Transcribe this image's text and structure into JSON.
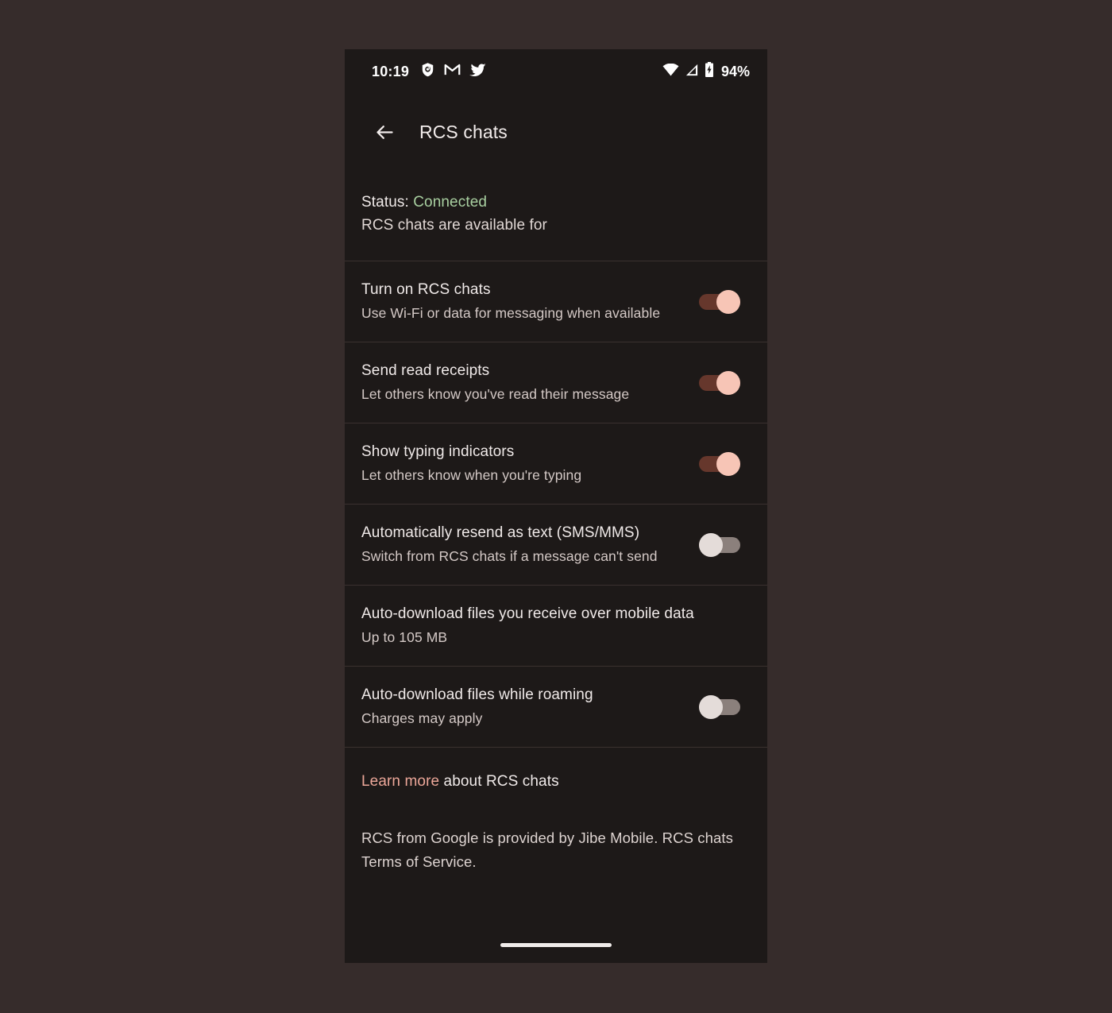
{
  "statusbar": {
    "time": "10:19",
    "notification_icons": [
      "shield-security-icon",
      "gmail-icon",
      "twitter-icon"
    ],
    "wifi_icon": "wifi-icon",
    "signal_icon": "cellular-signal-icon",
    "battery_icon": "battery-charging-icon",
    "battery_percent": "94%"
  },
  "appbar": {
    "back_icon": "back-arrow-icon",
    "title": "RCS chats"
  },
  "status_block": {
    "label": "Status:",
    "value": "Connected",
    "value_color": "#a9d0a1",
    "subtitle": "RCS chats are available for"
  },
  "settings": [
    {
      "title": "Turn on RCS chats",
      "subtitle": "Use Wi-Fi or data for messaging when available",
      "has_toggle": true,
      "toggle_state": "on"
    },
    {
      "title": "Send read receipts",
      "subtitle": "Let others know you've read their message",
      "has_toggle": true,
      "toggle_state": "on"
    },
    {
      "title": "Show typing indicators",
      "subtitle": "Let others know when you're typing",
      "has_toggle": true,
      "toggle_state": "on"
    },
    {
      "title": "Automatically resend as text (SMS/MMS)",
      "subtitle": "Switch from RCS chats if a message can't send",
      "has_toggle": true,
      "toggle_state": "off"
    },
    {
      "title": "Auto-download files you receive over mobile data",
      "subtitle": "Up to 105 MB",
      "has_toggle": false,
      "toggle_state": ""
    },
    {
      "title": "Auto-download files while roaming",
      "subtitle": "Charges may apply",
      "has_toggle": true,
      "toggle_state": "off"
    }
  ],
  "footer": {
    "learn_more_link": "Learn more",
    "learn_more_rest": " about RCS chats",
    "terms_text": "RCS from Google is provided by Jibe Mobile. RCS chats Terms of Service."
  },
  "colors": {
    "page_background": "#362c2b",
    "screen_background": "#1d1918",
    "accent_on_track": "#66372c",
    "accent_on_thumb": "#f7c5b6",
    "off_track": "#8b807c",
    "off_thumb": "#e4dcd9",
    "link": "#eca799",
    "divider": "#3a312f"
  }
}
